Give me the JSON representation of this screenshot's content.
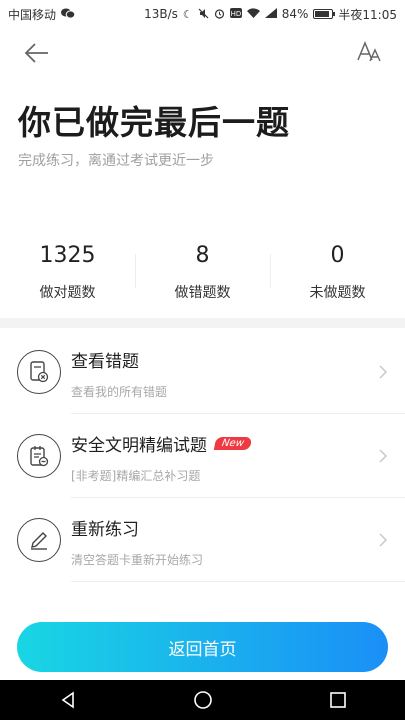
{
  "status_bar": {
    "carrier": "中国移动",
    "net_speed": "13B/s",
    "battery": "84%",
    "battery_level": 0.84,
    "time": "半夜11:05",
    "icons": [
      "wechat-icon",
      "moon-icon",
      "mute-icon",
      "alarm-icon",
      "hd-icon",
      "wifi-icon",
      "signal-icon",
      "battery-icon"
    ]
  },
  "nav": {
    "back_icon": "back-arrow-icon",
    "font_icon": "font-size-icon"
  },
  "header": {
    "title": "你已做完最后一题",
    "subtitle": "完成练习，离通过考试更近一步"
  },
  "stats": [
    {
      "value": "1325",
      "label": "做对题数"
    },
    {
      "value": "8",
      "label": "做错题数"
    },
    {
      "value": "0",
      "label": "未做题数"
    }
  ],
  "menu": [
    {
      "title": "查看错题",
      "desc": "查看我的所有错题",
      "icon": "wrong-question-icon"
    },
    {
      "title": "安全文明精编试题",
      "desc": "[非考题]精编汇总补习题",
      "icon": "exam-paper-icon",
      "badge": "New"
    },
    {
      "title": "重新练习",
      "desc": "清空答题卡重新开始练习",
      "icon": "pencil-icon"
    }
  ],
  "cta": {
    "label": "返回首页"
  },
  "colors": {
    "accent_start": "#19d6e3",
    "accent_end": "#1a8ff7",
    "badge": "#ee3b43"
  }
}
